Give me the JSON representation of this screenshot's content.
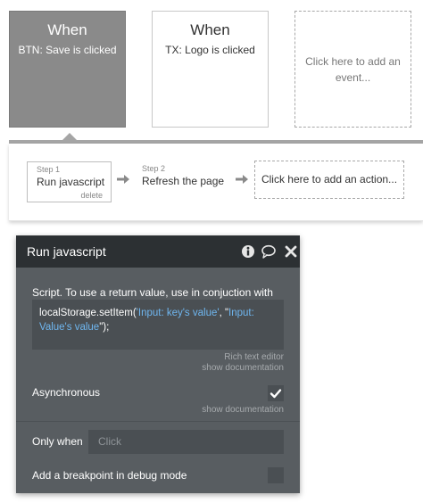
{
  "events": [
    {
      "title": "When",
      "subtitle": "BTN: Save is clicked"
    },
    {
      "title": "When",
      "subtitle": "TX: Logo is clicked"
    }
  ],
  "add_event_label": "Click here to add an event...",
  "steps": [
    {
      "number": "Step 1",
      "label": "Run javascript",
      "delete_label": "delete"
    },
    {
      "number": "Step 2",
      "label": "Refresh the page"
    }
  ],
  "add_action_label": "Click here to add an action...",
  "panel": {
    "title": "Run javascript",
    "script_label": "Script. To use a return value, use in conjuction with",
    "script_code": {
      "part1": "localStorage.setItem(",
      "part2": "'Input: key's value'",
      "part3": ", \"",
      "part4": "Input: Value's value",
      "part5": "\");"
    },
    "rich_text_editor": "Rich text editor",
    "show_documentation": "show documentation",
    "asynchronous_label": "Asynchronous",
    "asynchronous_checked": true,
    "only_when_label": "Only when",
    "only_when_placeholder": "Click",
    "breakpoint_label": "Add a breakpoint in debug mode",
    "breakpoint_checked": false
  },
  "colors": {
    "selected_event_bg": "#8a8a8a",
    "panel_bg": "#585d61",
    "panel_header_bg": "#2c3033",
    "dynamic_text": "#6fb6ef"
  },
  "icons": [
    "info-icon",
    "comment-icon",
    "close-icon",
    "arrow-right-icon",
    "checkmark-icon"
  ]
}
